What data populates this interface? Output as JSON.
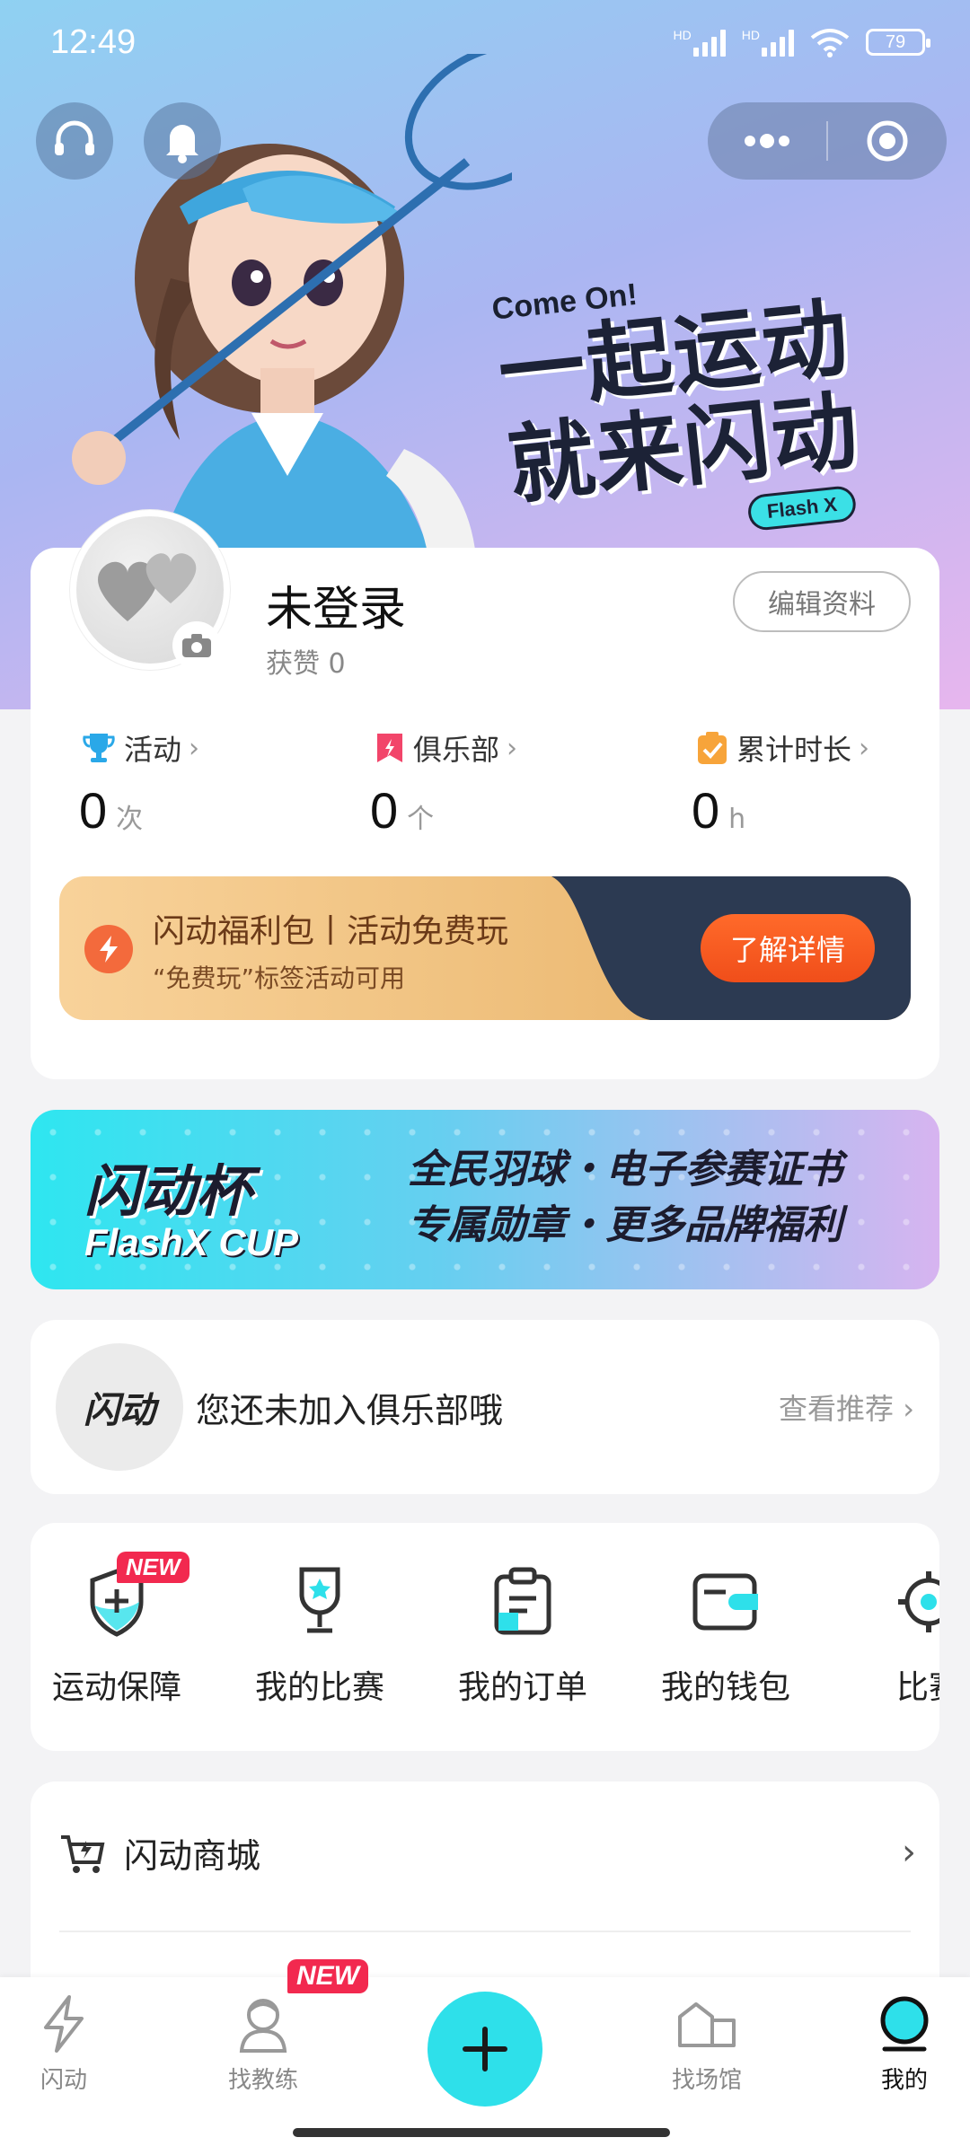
{
  "status_bar": {
    "time": "12:49",
    "battery": "79",
    "hd1": "HD",
    "hd2": "HD"
  },
  "hero": {
    "slogan_en": "Come On!",
    "slogan_line1": "一起运动",
    "slogan_line2": "就来闪动",
    "brand_tag": "Flash X"
  },
  "profile": {
    "username": "未登录",
    "likes_label": "获赞",
    "likes_value": "0",
    "edit_label": "编辑资料",
    "stats": [
      {
        "label": "活动",
        "value": "0",
        "unit": "次"
      },
      {
        "label": "俱乐部",
        "value": "0",
        "unit": "个"
      },
      {
        "label": "累计时长",
        "value": "0",
        "unit": "h"
      }
    ]
  },
  "welfare": {
    "title": "闪动福利包丨活动免费玩",
    "subtitle": "“免费玩”标签活动可用",
    "button": "了解详情"
  },
  "cup_banner": {
    "logo_cn": "闪动杯",
    "logo_en": "FlashX CUP",
    "line1": "全民羽球・电子参赛证书",
    "line2": "专属勋章・更多品牌福利"
  },
  "club": {
    "logo_text": "闪动",
    "message": "您还未加入俱乐部哦",
    "link": "查看推荐"
  },
  "tools": [
    {
      "label": "运动保障",
      "icon": "shield-plus-icon",
      "badge": "NEW"
    },
    {
      "label": "我的比赛",
      "icon": "trophy-icon"
    },
    {
      "label": "我的订单",
      "icon": "clipboard-icon"
    },
    {
      "label": "我的钱包",
      "icon": "wallet-icon"
    },
    {
      "label": "比赛",
      "icon": "gear-icon"
    }
  ],
  "mall": {
    "label": "闪动商城"
  },
  "tabbar": {
    "items": [
      {
        "label": "闪动",
        "icon": "lightning-icon"
      },
      {
        "label": "找教练",
        "icon": "coach-icon",
        "badge": "NEW"
      },
      {
        "label": "",
        "icon": "plus-icon"
      },
      {
        "label": "找场馆",
        "icon": "venue-icon"
      },
      {
        "label": "我的",
        "icon": "profile-icon",
        "active": true
      }
    ]
  },
  "colors": {
    "accent": "#2ee0ea",
    "orange": "#f04e1a",
    "badge": "#f2294f"
  }
}
